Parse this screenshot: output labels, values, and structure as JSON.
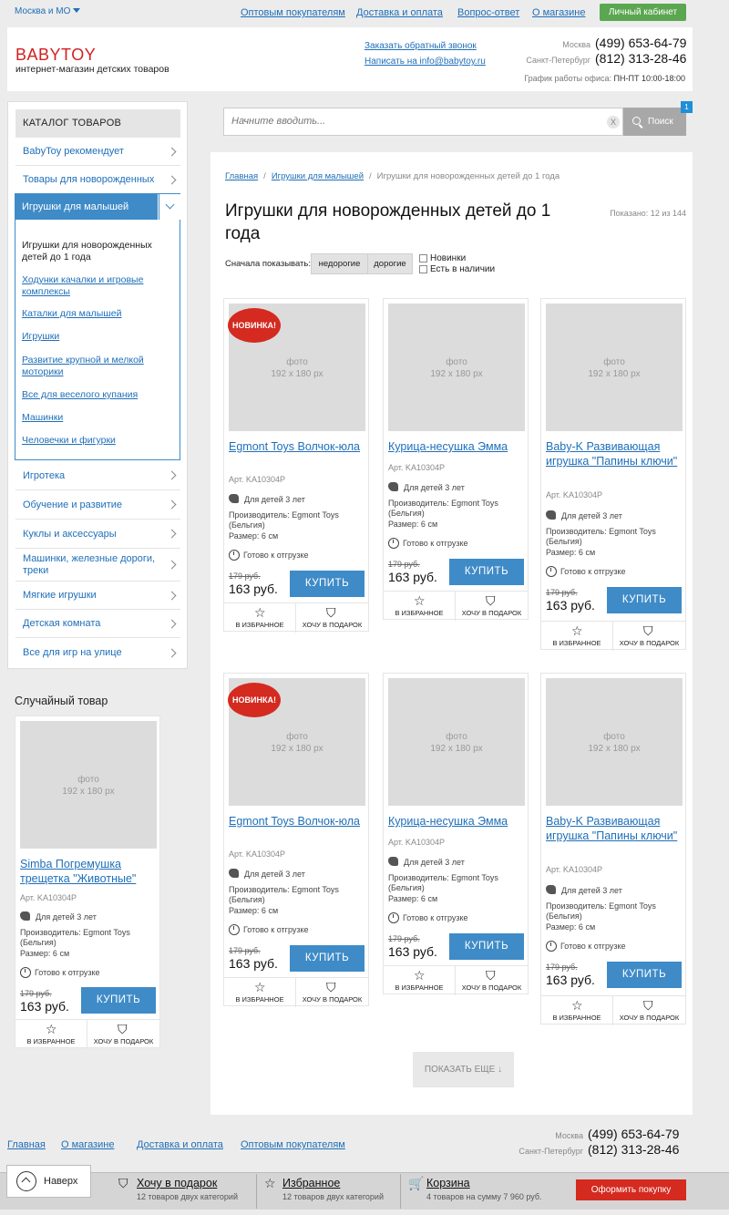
{
  "topbar": {
    "city": "Москва и МО",
    "nav": [
      "Оптовым покупателям",
      "Доставка и оплата",
      "Вопрос-ответ",
      "О магазине"
    ],
    "cabinet": "Личный кабинет"
  },
  "header": {
    "logo": "BABYTOY",
    "tagline": "интернет-магазин детских товаров",
    "callback": "Заказать обратный звонок",
    "email": "Написать на info@babytoy.ru",
    "phones": [
      {
        "city": "Москва",
        "number": "(499) 653-64-79"
      },
      {
        "city": "Санкт-Петербург",
        "number": "(812) 313-28-46"
      }
    ],
    "hours_label": "График работы офиса:",
    "hours_value": "ПН-ПТ 10:00-18:00"
  },
  "search": {
    "placeholder": "Начните вводить...",
    "clear": "X",
    "button": "Поиск",
    "badge": "1"
  },
  "catalog": {
    "title": "КАТАЛОГ ТОВАРОВ",
    "items_top": [
      "BabyToy рекомендует",
      "Товары для новорожденных"
    ],
    "open_item": "Игрушки для малышей",
    "sub_current": "Игрушки для новорожденных детей до 1 года",
    "sub_items": [
      "Ходунки качалки и игровые комплексы",
      "Каталки для малышей",
      "Игрушки",
      "Развитие крупной и мелкой моторики",
      "Все для веселого купания",
      "Машинки",
      "Человечки и фигурки"
    ],
    "items_bottom": [
      "Игротека",
      "Обучение и развитие",
      "Куклы и аксессуары",
      "Машинки, железные дороги, треки",
      "Мягкие игрушки",
      "Детская комната",
      "Все для игр на улице"
    ]
  },
  "random": {
    "title": "Случайный товар",
    "product": {
      "photo_line1": "фото",
      "photo_line2": "192 x 180 px",
      "name": "Simba Погремушка трещетка \"Животные\"",
      "art": "Арт. KA10304P",
      "age": "Для детей 3 лет",
      "maker": "Производитель: Egmont Toys (Бельгия)",
      "size": "Размер: 6 см",
      "ready": "Готово к отгрузке",
      "old_price": "179 руб.",
      "price": "163 руб.",
      "buy": "КУПИТЬ",
      "fav": "В ИЗБРАННОЕ",
      "gift": "ХОЧУ В ПОДАРОК"
    }
  },
  "breadcrumb": [
    "Главная",
    "Игрушки для малышей",
    "Игрушки для новорожденных детей до 1 года"
  ],
  "page": {
    "title": "Игрушки для новорожденных детей до 1 года",
    "shown": "Показано: 12 из 144",
    "sort_label": "Сначала показывать:",
    "sort_cheap": "недорогие",
    "sort_expensive": "дорогие",
    "filter_new": "Новинки",
    "filter_stock": "Есть в наличии"
  },
  "products": [
    {
      "badge": "НОВИНКА!",
      "photo_line1": "фото",
      "photo_line2": "192 x 180 px",
      "name": "Egmont Toys Волчок-юла",
      "art": "Арт. KA10304P",
      "age": "Для детей 3 лет",
      "maker": "Производитель: Egmont Toys (Бельгия)",
      "size": "Размер: 6 см",
      "ready": "Готово к отгрузке",
      "old_price": "179 руб.",
      "price": "163 руб.",
      "buy": "КУПИТЬ",
      "fav": "В ИЗБРАННОЕ",
      "gift": "ХОЧУ В ПОДАРОК"
    },
    {
      "badge": "",
      "photo_line1": "фото",
      "photo_line2": "192 x 180 px",
      "name": "Курица-несушка Эмма",
      "art": "Арт. KA10304P",
      "age": "Для детей 3 лет",
      "maker": "Производитель: Egmont Toys (Бельгия)",
      "size": "Размер: 6 см",
      "ready": "Готово к отгрузке",
      "old_price": "179 руб.",
      "price": "163 руб.",
      "buy": "КУПИТЬ",
      "fav": "В ИЗБРАННОЕ",
      "gift": "ХОЧУ В ПОДАРОК"
    },
    {
      "badge": "",
      "photo_line1": "фото",
      "photo_line2": "192 x 180 px",
      "name": "Baby-K Развивающая игрушка \"Папины ключи\"",
      "art": "Арт. KA10304P",
      "age": "Для детей 3 лет",
      "maker": "Производитель: Egmont Toys (Бельгия)",
      "size": "Размер: 6 см",
      "ready": "Готово к отгрузке",
      "old_price": "179 руб.",
      "price": "163 руб.",
      "buy": "КУПИТЬ",
      "fav": "В ИЗБРАННОЕ",
      "gift": "ХОЧУ В ПОДАРОК"
    },
    {
      "badge": "НОВИНКА!",
      "photo_line1": "фото",
      "photo_line2": "192 x 180 px",
      "name": "Egmont Toys Волчок-юла",
      "art": "Арт. KA10304P",
      "age": "Для детей 3 лет",
      "maker": "Производитель: Egmont Toys (Бельгия)",
      "size": "Размер: 6 см",
      "ready": "Готово к отгрузке",
      "old_price": "179 руб.",
      "price": "163 руб.",
      "buy": "КУПИТЬ",
      "fav": "В ИЗБРАННОЕ",
      "gift": "ХОЧУ В ПОДАРОК"
    },
    {
      "badge": "",
      "photo_line1": "фото",
      "photo_line2": "192 x 180 px",
      "name": "Курица-несушка Эмма",
      "art": "Арт. KA10304P",
      "age": "Для детей 3 лет",
      "maker": "Производитель: Egmont Toys (Бельгия)",
      "size": "Размер: 6 см",
      "ready": "Готово к отгрузке",
      "old_price": "179 руб.",
      "price": "163 руб.",
      "buy": "КУПИТЬ",
      "fav": "В ИЗБРАННОЕ",
      "gift": "ХОЧУ В ПОДАРОК"
    },
    {
      "badge": "",
      "photo_line1": "фото",
      "photo_line2": "192 x 180 px",
      "name": "Baby-K Развивающая игрушка \"Папины ключи\"",
      "art": "Арт. KA10304P",
      "age": "Для детей 3 лет",
      "maker": "Производитель: Egmont Toys (Бельгия)",
      "size": "Размер: 6 см",
      "ready": "Готово к отгрузке",
      "old_price": "179 руб.",
      "price": "163 руб.",
      "buy": "КУПИТЬ",
      "fav": "В ИЗБРАННОЕ",
      "gift": "ХОЧУ В ПОДАРОК"
    }
  ],
  "more": "ПОКАЗАТЬ ЕЩЕ ↓",
  "footer": {
    "nav": [
      "Главная",
      "О магазине",
      "Доставка и оплата",
      "Оптовым покупателям"
    ],
    "phones": [
      {
        "city": "Москва",
        "number": "(499) 653-64-79"
      },
      {
        "city": "Санкт-Петербург",
        "number": "(812) 313-28-46"
      }
    ]
  },
  "bottombar": {
    "back": "Наверх",
    "gift_title": "Хочу в подарок",
    "gift_sub": "12 товаров двух категорий",
    "fav_title": "Избранное",
    "fav_sub": "12 товаров двух категорий",
    "cart_title": "Корзина",
    "cart_sub": "4 товаров на сумму 7 960 руб.",
    "checkout": "Оформить покупку"
  },
  "colors": {
    "accent": "#3f8bc7",
    "brand": "#d32020",
    "cta_green": "#5ba650",
    "sale_red": "#d42a1f"
  }
}
